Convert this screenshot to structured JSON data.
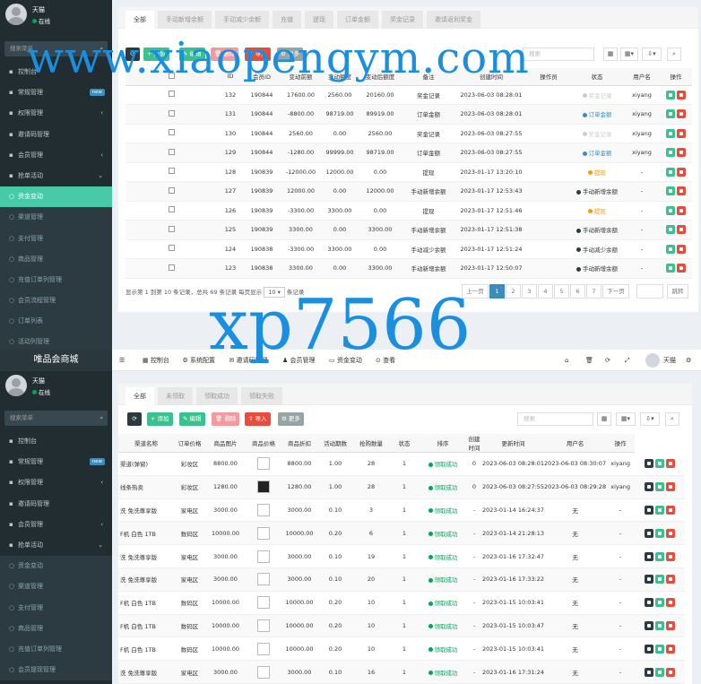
{
  "p1": {
    "user": {
      "name": "天猫",
      "status": "在线"
    },
    "search_placeholder": "搜索菜单",
    "menu": [
      {
        "label": "控制台",
        "icon": "dashboard-icon"
      },
      {
        "label": "常规管理",
        "badge": "new"
      },
      {
        "label": "权限管理",
        "chev": "‹"
      },
      {
        "label": "邀请码管理",
        "sub": false
      },
      {
        "label": "会员管理",
        "chev": "‹"
      },
      {
        "label": "抢单活动",
        "chev": "⌄"
      },
      {
        "label": "资金变动",
        "active": true
      },
      {
        "label": "渠道管理",
        "sub": true
      },
      {
        "label": "支付管理",
        "sub": true
      },
      {
        "label": "商品管理",
        "sub": true
      },
      {
        "label": "充值订单列管理",
        "sub": true
      },
      {
        "label": "会员流程管理",
        "sub": true
      },
      {
        "label": "订单列表",
        "sub": true
      },
      {
        "label": "活动列管理",
        "sub": true
      }
    ],
    "tabs": [
      "全部",
      "手动新增余额",
      "手动减少余额",
      "充值",
      "提现",
      "订单金额",
      "奖金记录",
      "邀请返利奖金"
    ],
    "toolbar": {
      "add": "添加",
      "edit": "编辑",
      "del": "删除",
      "import": "导入",
      "more": "更多",
      "search": "搜索"
    },
    "headers": [
      "ID",
      "会员ID",
      "变动前额",
      "变动额度",
      "变动后额度",
      "备注",
      "创建时间",
      "操作员",
      "状态",
      "用户名",
      "操作"
    ],
    "rows": [
      [
        "132",
        "190844",
        "17600.00",
        "2560.00",
        "20160.00",
        "奖金记录",
        "2023-06-03 08:28:01",
        "",
        "奖金记录",
        "xiyang"
      ],
      [
        "131",
        "190844",
        "-8800.00",
        "98719.00",
        "89919.00",
        "订单金额",
        "2023-06-03 08:28:01",
        "",
        "订单金额",
        "xiyang"
      ],
      [
        "130",
        "190844",
        "2560.00",
        "0.00",
        "2560.00",
        "奖金记录",
        "2023-06-03 08:27:55",
        "",
        "奖金记录",
        "xiyang"
      ],
      [
        "129",
        "190844",
        "-1280.00",
        "99999.00",
        "98719.00",
        "订单金额",
        "2023-06-03 08:27:55",
        "",
        "订单金额",
        "xiyang"
      ],
      [
        "128",
        "190839",
        "-12000.00",
        "12000.00",
        "0.00",
        "提现",
        "2023-01-17 13:20:10",
        "",
        "提现",
        "-"
      ],
      [
        "127",
        "190839",
        "12000.00",
        "0.00",
        "12000.00",
        "手动新增余额",
        "2023-01-17 12:53:43",
        "",
        "手动新增余额",
        "-"
      ],
      [
        "126",
        "190839",
        "-3300.00",
        "3300.00",
        "0.00",
        "提现",
        "2023-01-17 12:51:46",
        "",
        "提现",
        "-"
      ],
      [
        "125",
        "190839",
        "3300.00",
        "0.00",
        "3300.00",
        "手动新增余额",
        "2023-01-17 12:51:38",
        "",
        "手动新增余额",
        "-"
      ],
      [
        "124",
        "190838",
        "-3300.00",
        "3300.00",
        "0.00",
        "手动减少余额",
        "2023-01-17 12:51:24",
        "",
        "手动减少余额",
        "-"
      ],
      [
        "123",
        "190838",
        "3300.00",
        "0.00",
        "3300.00",
        "手动新增余额",
        "2023-01-17 12:50:07",
        "",
        "手动新增余额",
        "-"
      ]
    ],
    "status_colors": [
      "#cccccc",
      "#3c8dbc",
      "#cccccc",
      "#3c8dbc",
      "#f39c12",
      "#2c3b41",
      "#f39c12",
      "#2c3b41",
      "#2c3b41",
      "#2c3b41"
    ],
    "summary": "显示第 1 到第 10 条记录，总共 69 条记录 每页显示",
    "page_size": "10",
    "page_suffix": "条记录",
    "pages": [
      "上一页",
      "1",
      "2",
      "3",
      "4",
      "5",
      "6",
      "7",
      "下一页"
    ],
    "jump": "跳转"
  },
  "p2": {
    "brand": "唯品会商城",
    "user": {
      "name": "天猫",
      "status": "在线"
    },
    "search_placeholder": "搜索菜单",
    "menu": [
      {
        "label": "控制台"
      },
      {
        "label": "常规管理",
        "badge": "new"
      },
      {
        "label": "权限管理",
        "chev": "‹"
      },
      {
        "label": "邀请码管理"
      },
      {
        "label": "会员管理",
        "chev": "‹"
      },
      {
        "label": "抢单活动",
        "chev": "⌄"
      },
      {
        "label": "资金变动",
        "sub": true
      },
      {
        "label": "渠道管理",
        "sub": true
      },
      {
        "label": "支付管理",
        "sub": true
      },
      {
        "label": "商品管理",
        "sub": true
      },
      {
        "label": "充值订单列管理",
        "sub": true
      },
      {
        "label": "会员提现管理",
        "sub": true
      }
    ],
    "topnav": [
      "控制台",
      "系统配置",
      "邀请码管理",
      "会员管理",
      "资金变动",
      "查看"
    ],
    "top_user": "天猫",
    "tabs": [
      "全部",
      "未领取",
      "领取成功",
      "领取失败"
    ],
    "toolbar": {
      "add": "添加",
      "edit": "编辑",
      "del": "删除",
      "import": "导入",
      "more": "更多",
      "search": "搜索"
    },
    "headers": [
      "渠道名称",
      "订单价格",
      "商品图片",
      "商品价格",
      "商品折扣",
      "活动期数",
      "抢购数量",
      "状态",
      "排序",
      "创建时间",
      "更新时间",
      "用户名",
      "操作"
    ],
    "rows": [
      [
        "渠道(弹窗)",
        "彩妆区",
        "8800.00",
        "img",
        "8800.00",
        "1.00",
        "28",
        "1",
        "领取成功",
        "0",
        "2023-06-03 08:28:01",
        "2023-06-03 08:30:07",
        "xiyang"
      ],
      [
        "线条热卖",
        "彩妆区",
        "1280.00",
        "dark",
        "1280.00",
        "1.00",
        "28",
        "1",
        "领取成功",
        "0",
        "2023-06-03 08:27:55",
        "2023-06-03 08:29:28",
        "xiyang"
      ],
      [
        "洗 免洗尊享版",
        "家电区",
        "3000.00",
        "box",
        "3000.00",
        "0.10",
        "3",
        "1",
        "领取成功",
        "-",
        "2023-01-14 16:24:37",
        "无",
        "-"
      ],
      [
        "F机 白色 1TB",
        "数码区",
        "10000.00",
        "box",
        "10000.00",
        "0.20",
        "6",
        "1",
        "领取成功",
        "-",
        "2023-01-14 21:28:13",
        "无",
        "-"
      ],
      [
        "洗 免洗尊享版",
        "家电区",
        "3000.00",
        "box",
        "3000.00",
        "0.10",
        "19",
        "1",
        "领取成功",
        "-",
        "2023-01-16 17:32:47",
        "无",
        "-"
      ],
      [
        "洗 免洗尊享版",
        "家电区",
        "3000.00",
        "box",
        "3000.00",
        "0.10",
        "20",
        "1",
        "领取成功",
        "-",
        "2023-01-16 17:33:22",
        "无",
        "-"
      ],
      [
        "F机 白色 1TB",
        "数码区",
        "10000.00",
        "box",
        "10000.00",
        "0.20",
        "10",
        "1",
        "领取成功",
        "-",
        "2023-01-15 10:03:41",
        "无",
        "-"
      ],
      [
        "F机 白色 1TB",
        "数码区",
        "10000.00",
        "box",
        "10000.00",
        "0.20",
        "10",
        "1",
        "领取成功",
        "-",
        "2023-01-15 10:03:47",
        "无",
        "-"
      ],
      [
        "F机 白色 1TB",
        "数码区",
        "10000.00",
        "box",
        "10000.00",
        "0.20",
        "10",
        "1",
        "领取成功",
        "-",
        "2023-01-15 10:03:41",
        "无",
        "-"
      ],
      [
        "洗 免洗尊享版",
        "家电区",
        "3000.00",
        "box",
        "3000.00",
        "0.10",
        "16",
        "1",
        "领取成功",
        "-",
        "2023-01-16 17:31:24",
        "无",
        "-"
      ]
    ]
  },
  "watermark": {
    "url": "www.xiaopengym.com",
    "code": "xp7566"
  }
}
